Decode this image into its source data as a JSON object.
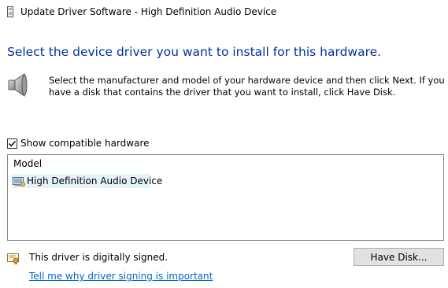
{
  "window": {
    "title": "Update Driver Software - High Definition Audio Device"
  },
  "page": {
    "heading": "Select the device driver you want to install for this hardware.",
    "instructions": "Select the manufacturer and model of your hardware device and then click Next. If you have a disk that contains the driver that you want to install, click Have Disk."
  },
  "compatible": {
    "label": "Show compatible hardware",
    "checked": true
  },
  "model_list": {
    "header": "Model",
    "items": [
      {
        "label": "High Definition Audio Device",
        "selected": true
      }
    ]
  },
  "status": {
    "signed_text": "This driver is digitally signed."
  },
  "buttons": {
    "have_disk": "Have Disk..."
  },
  "links": {
    "signing_info": "Tell me why driver signing is important"
  },
  "icons": {
    "title": "device-icon",
    "speaker": "speaker-icon",
    "device": "sound-device-icon",
    "certificate": "certificate-icon"
  },
  "colors": {
    "heading": "#003399",
    "link": "#0066cc",
    "selection": "#e5f3fb"
  }
}
